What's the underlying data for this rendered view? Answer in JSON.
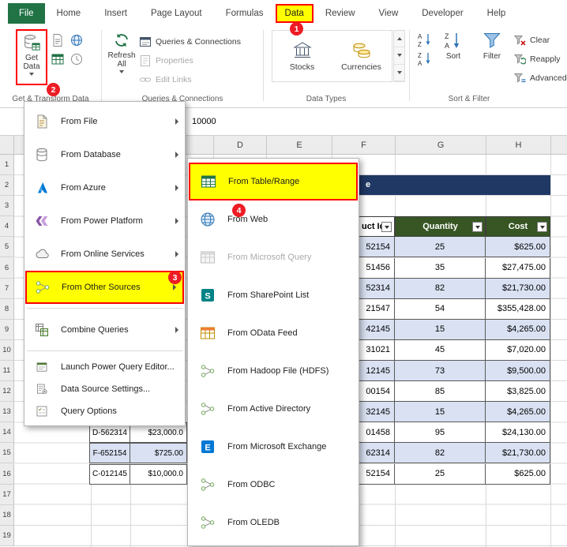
{
  "colors": {
    "excel_green": "#217346",
    "highlight_yellow": "#FFFF00",
    "annotation_red": "#FF0000",
    "callout_red": "#ED1C24",
    "table_header_green": "#375623",
    "banded_row_blue": "#D9E1F2",
    "banner_navy": "#1F3864"
  },
  "ribbon": {
    "tabs": [
      "File",
      "Home",
      "Insert",
      "Page Layout",
      "Formulas",
      "Data",
      "Review",
      "View",
      "Developer",
      "Help"
    ],
    "active_tab": "Data",
    "get_data_label": "Get Data",
    "refresh_all_label": "Refresh All",
    "queries_connections_label": "Queries & Connections",
    "properties_label": "Properties",
    "edit_links_label": "Edit Links",
    "stocks_label": "Stocks",
    "currencies_label": "Currencies",
    "sort_label": "Sort",
    "filter_label": "Filter",
    "clear_label": "Clear",
    "reapply_label": "Reapply",
    "advanced_label": "Advanced",
    "group_get_transform": "Get & Transform Data",
    "group_queries": "Queries & Connections",
    "group_data_types": "Data Types",
    "group_sort_filter": "Sort & Filter"
  },
  "callouts": {
    "one": "1",
    "two": "2",
    "three": "3",
    "four": "4"
  },
  "formula_bar": {
    "value": "10000"
  },
  "get_data_menu": {
    "items": [
      {
        "label": "From File",
        "icon": "file-icon",
        "has_submenu": true
      },
      {
        "label": "From Database",
        "icon": "database-icon",
        "has_submenu": true
      },
      {
        "label": "From Azure",
        "icon": "azure-icon",
        "has_submenu": true
      },
      {
        "label": "From Power Platform",
        "icon": "power-platform-icon",
        "has_submenu": true
      },
      {
        "label": "From Online Services",
        "icon": "online-services-icon",
        "has_submenu": true
      },
      {
        "label": "From Other Sources",
        "icon": "other-sources-icon",
        "has_submenu": true,
        "highlighted": true
      },
      {
        "label": "Combine Queries",
        "icon": "combine-queries-icon",
        "has_submenu": true
      },
      {
        "label": "Launch Power Query Editor...",
        "icon": "power-query-editor-icon"
      },
      {
        "label": "Data Source Settings...",
        "icon": "data-source-settings-icon"
      },
      {
        "label": "Query Options",
        "icon": "query-options-icon"
      }
    ]
  },
  "other_sources_submenu": {
    "items": [
      {
        "label": "From Table/Range",
        "icon": "table-range-icon",
        "highlighted": true
      },
      {
        "label": "From Web",
        "icon": "globe-icon"
      },
      {
        "label": "From Microsoft Query",
        "icon": "microsoft-query-icon",
        "disabled": true
      },
      {
        "label": "From SharePoint List",
        "icon": "sharepoint-icon"
      },
      {
        "label": "From OData Feed",
        "icon": "odata-icon"
      },
      {
        "label": "From Hadoop File (HDFS)",
        "icon": "hadoop-icon"
      },
      {
        "label": "From Active Directory",
        "icon": "active-directory-icon"
      },
      {
        "label": "From Microsoft Exchange",
        "icon": "exchange-icon"
      },
      {
        "label": "From ODBC",
        "icon": "odbc-icon"
      },
      {
        "label": "From OLEDB",
        "icon": "oledb-icon"
      }
    ]
  },
  "sheet": {
    "column_headers": [
      "D",
      "E",
      "F",
      "G",
      "H"
    ],
    "row_numbers": [
      "1",
      "2",
      "3",
      "4",
      "5",
      "6",
      "7",
      "8",
      "9",
      "10",
      "11",
      "12",
      "13",
      "14",
      "15",
      "16",
      "17",
      "18",
      "19"
    ],
    "banner_text_fragment": "e",
    "right_table": {
      "headers": {
        "product_id": "uct Id",
        "quantity": "Quantity",
        "cost": "Cost"
      },
      "rows": [
        {
          "id": "52154",
          "qty": "25",
          "cost": "$625.00"
        },
        {
          "id": "51456",
          "qty": "35",
          "cost": "$27,475.00"
        },
        {
          "id": "52314",
          "qty": "82",
          "cost": "$21,730.00"
        },
        {
          "id": "21547",
          "qty": "54",
          "cost": "$355,428.00"
        },
        {
          "id": "42145",
          "qty": "15",
          "cost": "$4,265.00"
        },
        {
          "id": "31021",
          "qty": "45",
          "cost": "$7,020.00"
        },
        {
          "id": "12145",
          "qty": "73",
          "cost": "$9,500.00"
        },
        {
          "id": "00154",
          "qty": "85",
          "cost": "$3,825.00"
        },
        {
          "id": "32145",
          "qty": "15",
          "cost": "$4,265.00"
        },
        {
          "id": "01458",
          "qty": "95",
          "cost": "$24,130.00"
        },
        {
          "id": "62314",
          "qty": "82",
          "cost": "$21,730.00"
        },
        {
          "id": "52154",
          "qty": "25",
          "cost": "$625.00"
        }
      ]
    },
    "left_table": {
      "rows": [
        {
          "id": "D-562314",
          "cost": "$23,000.0"
        },
        {
          "id": "F-652154",
          "cost": "$725.00"
        },
        {
          "id": "C-012145",
          "cost": "$10,000.0"
        }
      ]
    }
  }
}
